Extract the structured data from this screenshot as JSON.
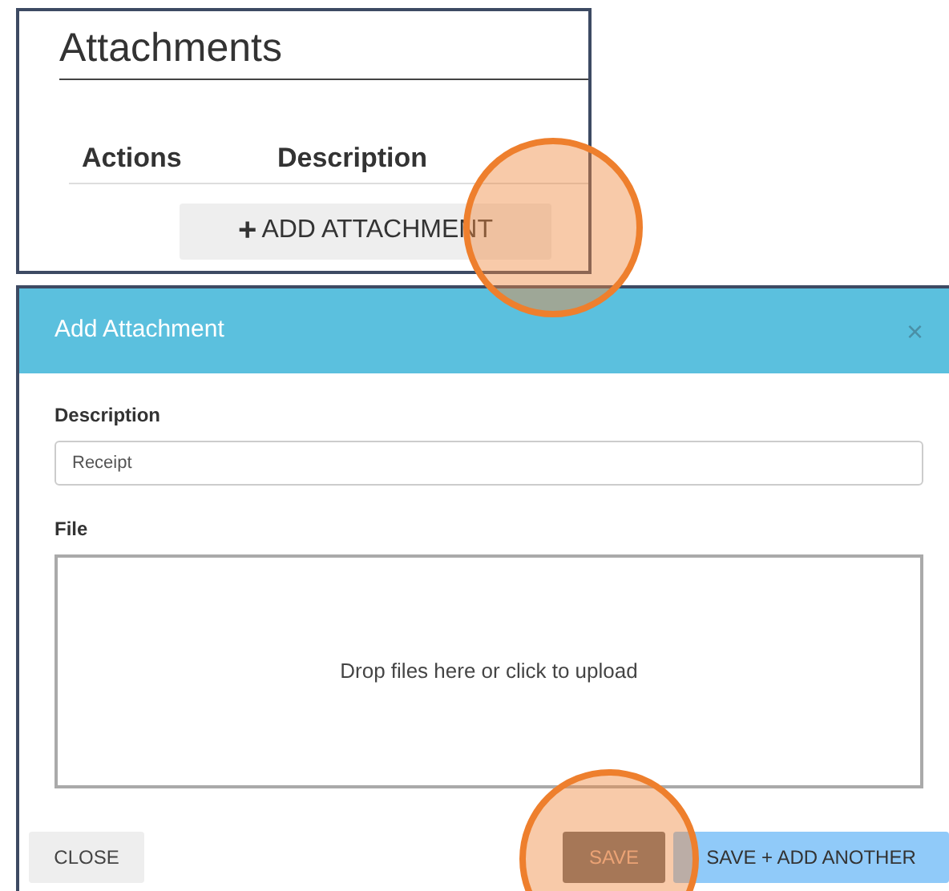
{
  "attachments_panel": {
    "title": "Attachments",
    "columns": [
      "Actions",
      "Description"
    ],
    "add_button": {
      "icon": "+",
      "label": "ADD ATTACHMENT"
    }
  },
  "dialog": {
    "title": "Add Attachment",
    "close_icon": "×",
    "fields": [
      {
        "label": "Description",
        "kind": "text",
        "value": "Receipt"
      },
      {
        "label": "File",
        "kind": "dropzone",
        "placeholder": "Drop files here or click to upload"
      }
    ],
    "buttons": [
      {
        "label": "CLOSE",
        "kind": "default"
      },
      {
        "label": "SAVE",
        "kind": "dark"
      },
      {
        "label": "SAVE + ADD ANOTHER",
        "kind": "info"
      }
    ]
  }
}
